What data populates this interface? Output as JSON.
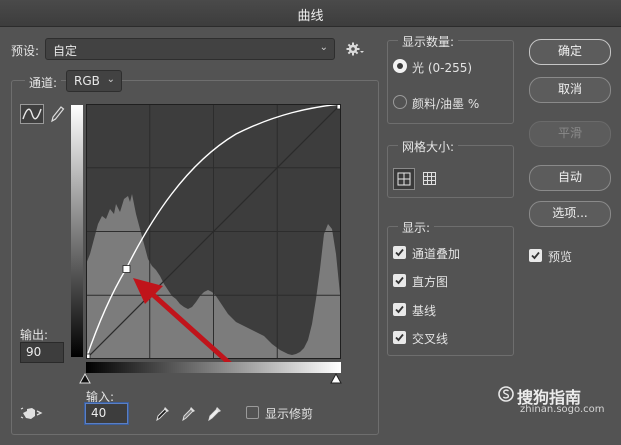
{
  "window": {
    "title": "曲线"
  },
  "preset": {
    "label": "预设:",
    "value": "自定"
  },
  "channel": {
    "label": "通道:",
    "value": "RGB"
  },
  "output": {
    "label": "输出:",
    "value": "90"
  },
  "input": {
    "label": "输入:",
    "value": "40"
  },
  "show_clipping": {
    "label": "显示修剪",
    "checked": false
  },
  "show_amount": {
    "title": "显示数量:",
    "options": [
      {
        "label": "光 (0-255)",
        "selected": true
      },
      {
        "label": "颜料/油墨 %",
        "selected": false
      }
    ]
  },
  "grid_size": {
    "title": "网格大小:"
  },
  "show": {
    "title": "显示:",
    "options": [
      {
        "label": "通道叠加",
        "checked": true
      },
      {
        "label": "直方图",
        "checked": true
      },
      {
        "label": "基线",
        "checked": true
      },
      {
        "label": "交叉线",
        "checked": true
      }
    ]
  },
  "buttons": {
    "ok": "确定",
    "cancel": "取消",
    "smooth": "平滑",
    "auto": "自动",
    "options": "选项..."
  },
  "preview": {
    "label": "预览",
    "checked": true
  },
  "watermark": {
    "brand": "搜狗指南",
    "url": "zhinan.sogo.com"
  },
  "curve": {
    "control_point": {
      "input": 40,
      "output": 90
    }
  },
  "colors": {
    "accent_arrow": "#c0141b",
    "dialog_bg": "#535353"
  }
}
